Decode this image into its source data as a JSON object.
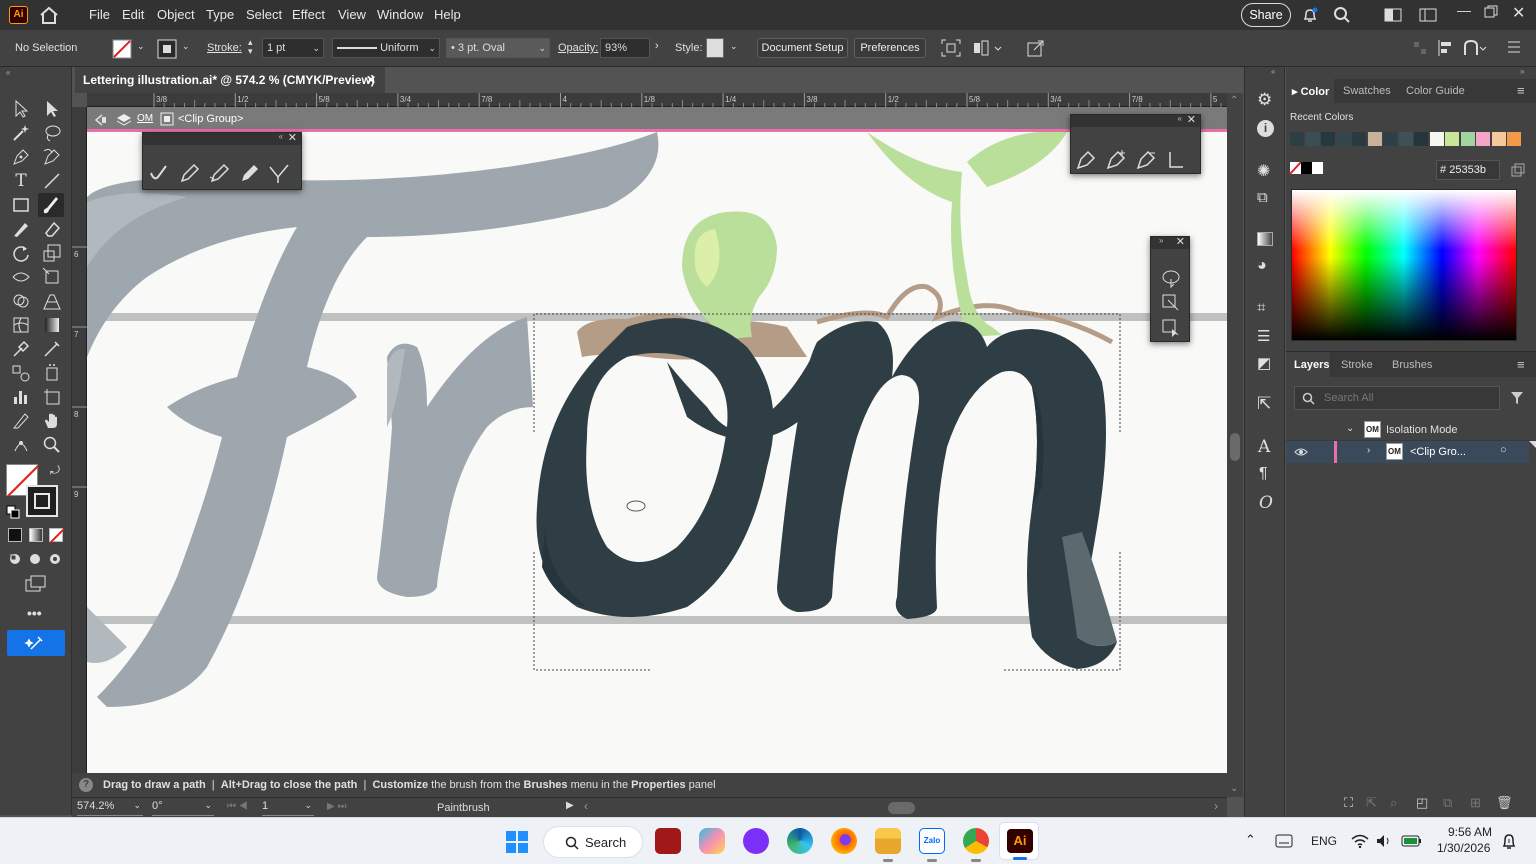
{
  "app": {
    "logo": "Ai"
  },
  "menu": [
    "File",
    "Edit",
    "Object",
    "Type",
    "Select",
    "Effect",
    "View",
    "Window",
    "Help"
  ],
  "share_label": "Share",
  "control": {
    "selection": "No Selection",
    "stroke_label": "Stroke:",
    "stroke_value": "1 pt",
    "profile": "Uniform",
    "brush": "3 pt. Oval",
    "opacity_label": "Opacity:",
    "opacity_value": "93%",
    "style_label": "Style:",
    "document_setup": "Document Setup",
    "preferences": "Preferences"
  },
  "document": {
    "tab_title": "Lettering illustration.ai* @ 574.2 % (CMYK/Preview)"
  },
  "isolation": {
    "om_label": "OM",
    "group_label": "<Clip Group>"
  },
  "ruler_top": [
    "3/8",
    "1/2",
    "5/8",
    "3/4",
    "7/8",
    "4",
    "1/8",
    "1/4",
    "3/8",
    "1/2",
    "5/8",
    "3/4",
    "7/8",
    "5"
  ],
  "ruler_left": [
    "6",
    "7",
    "8",
    "9"
  ],
  "status": {
    "message_1": "Drag to draw a path",
    "message_2": "Alt+Drag to close the path",
    "message_3_bold": "Customize",
    "message_3": "the brush from the",
    "message_4_bold": "Brushes",
    "message_4": "menu in the",
    "message_5_bold": "Properties",
    "message_5": "panel",
    "zoom": "574.2%",
    "rotation": "0°",
    "artboard": "1",
    "tool": "Paintbrush"
  },
  "color_panel": {
    "tabs": [
      "Color",
      "Swatches",
      "Color Guide"
    ],
    "recent_label": "Recent Colors",
    "hex_value": "25353b",
    "recent_colors": [
      "#2f3e44",
      "#3b4d55",
      "#27383e",
      "#34454c",
      "#2a3a40",
      "#c8b19a",
      "#2e3f45",
      "#3e5158",
      "#25353b",
      "#f7f7f2",
      "#c9e59a",
      "#a3d3a0",
      "#f4a6c8",
      "#f5c79a",
      "#f19a4a"
    ]
  },
  "layers_panel": {
    "tabs": [
      "Layers",
      "Stroke",
      "Brushes"
    ],
    "search_placeholder": "Search All",
    "rows": [
      {
        "label": "Isolation Mode"
      },
      {
        "label": "<Clip Gro..."
      }
    ]
  },
  "taskbar": {
    "search_label": "Search",
    "language": "ENG",
    "time": "9:56 AM",
    "date": "1/30/2026"
  },
  "colors": {
    "pink_accent": "#ea6ea8",
    "letter_grey": "#9da7ad",
    "letter_dark": "#2f3e44",
    "sprout_green": "#b9df9a",
    "root_tan": "#b59c86",
    "selection_blue": "#1473e6"
  }
}
